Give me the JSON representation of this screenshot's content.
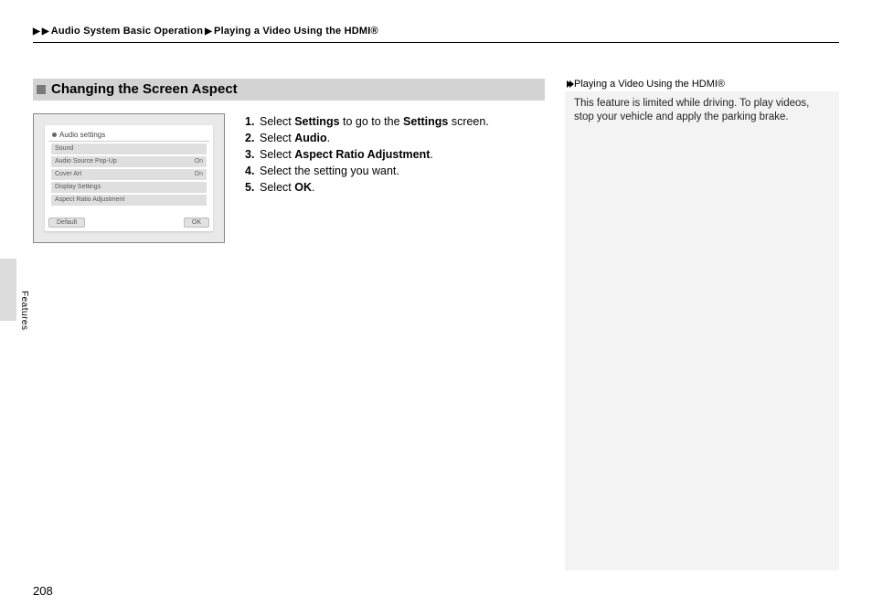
{
  "breadcrumb": {
    "level1": "Audio System Basic Operation",
    "level2": "Playing a Video Using the HDMI®"
  },
  "section": {
    "title": "Changing the Screen Aspect"
  },
  "thumbnail": {
    "header": "Audio settings",
    "rows": [
      {
        "label": "Sound",
        "value": ""
      },
      {
        "label": "Audio Source Pop-Up",
        "value": "On"
      },
      {
        "label": "Cover Art",
        "value": "On"
      },
      {
        "label": "Display Settings",
        "value": ""
      },
      {
        "label": "Aspect Ratio Adjustment",
        "value": ""
      }
    ],
    "btn_default": "Default",
    "btn_ok": "OK"
  },
  "steps": [
    {
      "num": "1.",
      "parts": [
        "Select ",
        "Settings",
        " to go to the ",
        "Settings",
        " screen."
      ]
    },
    {
      "num": "2.",
      "parts": [
        "Select ",
        "Audio",
        "."
      ]
    },
    {
      "num": "3.",
      "parts": [
        "Select ",
        "Aspect Ratio Adjustment",
        "."
      ]
    },
    {
      "num": "4.",
      "parts": [
        "Select the setting you want."
      ]
    },
    {
      "num": "5.",
      "parts": [
        "Select ",
        "OK",
        "."
      ]
    }
  ],
  "sidebar": {
    "title": "Playing a Video Using the HDMI®",
    "body": "This feature is limited while driving. To play videos, stop your vehicle and apply the parking brake."
  },
  "side_tab_label": "Features",
  "page_number": "208"
}
